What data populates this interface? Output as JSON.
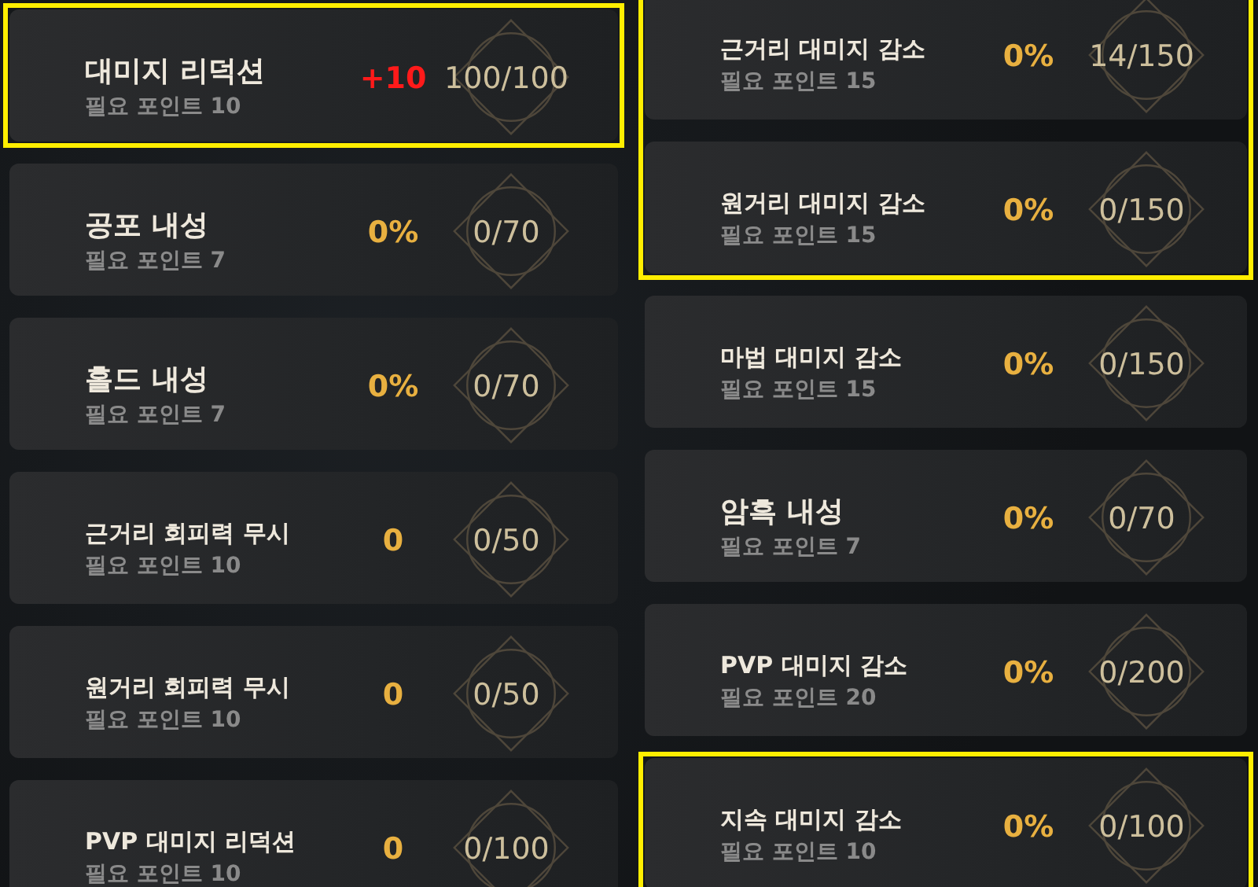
{
  "columns": [
    {
      "items": [
        {
          "name": "대미지 리덕션",
          "required": "필요 포인트 10",
          "value": "+10",
          "color": "#ff1a1a",
          "count": "100/100",
          "highlighted": true
        },
        {
          "name": "공포 내성",
          "required": "필요 포인트 7",
          "value": "0%",
          "color": "#e8b040",
          "count": "0/70",
          "highlighted": false
        },
        {
          "name": "홀드 내성",
          "required": "필요 포인트 7",
          "value": "0%",
          "color": "#e8b040",
          "count": "0/70",
          "highlighted": false
        },
        {
          "name": "근거리 회피력 무시",
          "required": "필요 포인트 10",
          "value": "0",
          "color": "#e8b040",
          "count": "0/50",
          "highlighted": false
        },
        {
          "name": "원거리 회피력 무시",
          "required": "필요 포인트 10",
          "value": "0",
          "color": "#e8b040",
          "count": "0/50",
          "highlighted": false
        },
        {
          "name": "PVP 대미지 리덕션",
          "required": "필요 포인트 10",
          "value": "0",
          "color": "#e8b040",
          "count": "0/100",
          "highlighted": false
        }
      ]
    },
    {
      "items": [
        {
          "name": "근거리 대미지 감소",
          "required": "필요 포인트 15",
          "value": "0%",
          "color": "#e8b040",
          "count": "14/150",
          "highlighted": true
        },
        {
          "name": "원거리 대미지 감소",
          "required": "필요 포인트 15",
          "value": "0%",
          "color": "#e8b040",
          "count": "0/150",
          "highlighted": true
        },
        {
          "name": "마법 대미지 감소",
          "required": "필요 포인트 15",
          "value": "0%",
          "color": "#e8b040",
          "count": "0/150",
          "highlighted": false
        },
        {
          "name": "암흑 내성",
          "required": "필요 포인트 7",
          "value": "0%",
          "color": "#e8b040",
          "count": "0/70",
          "highlighted": false
        },
        {
          "name": "PVP 대미지 감소",
          "required": "필요 포인트 20",
          "value": "0%",
          "color": "#e8b040",
          "count": "0/200",
          "highlighted": false
        },
        {
          "name": "지속 대미지 감소",
          "required": "필요 포인트 10",
          "value": "0%",
          "color": "#e8b040",
          "count": "0/100",
          "highlighted": true
        }
      ]
    }
  ]
}
